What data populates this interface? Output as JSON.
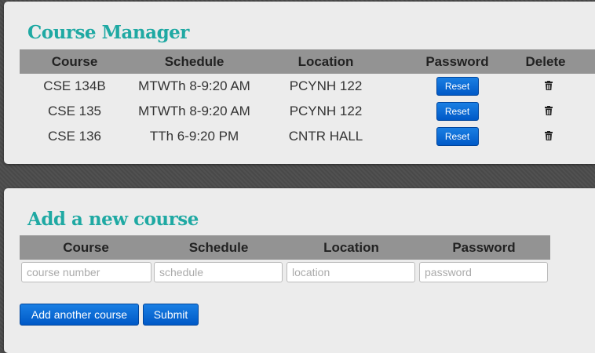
{
  "manager": {
    "title": "Course Manager",
    "headers": [
      "Course",
      "Schedule",
      "Location",
      "Password",
      "Delete"
    ],
    "rows": [
      {
        "course": "CSE 134B",
        "schedule": "MTWTh 8-9:20 AM",
        "location": "PCYNH 122",
        "reset_label": "Reset",
        "delete_icon": "trash-icon"
      },
      {
        "course": "CSE 135",
        "schedule": "MTWTh 8-9:20 AM",
        "location": "PCYNH 122",
        "reset_label": "Reset",
        "delete_icon": "trash-icon"
      },
      {
        "course": "CSE 136",
        "schedule": "TTh 6-9:20 PM",
        "location": "CNTR HALL",
        "reset_label": "Reset",
        "delete_icon": "trash-icon"
      }
    ]
  },
  "add": {
    "title": "Add a new course",
    "headers": [
      "Course",
      "Schedule",
      "Location",
      "Password"
    ],
    "fields": [
      {
        "placeholder": "course number",
        "value": ""
      },
      {
        "placeholder": "schedule",
        "value": ""
      },
      {
        "placeholder": "location",
        "value": ""
      },
      {
        "placeholder": "password",
        "value": ""
      }
    ],
    "add_another_label": "Add another course",
    "submit_label": "Submit"
  },
  "colors": {
    "title": "#1fa9a3",
    "header_bg": "#939393",
    "button": "#0a6ad6",
    "panel": "#ececec"
  }
}
